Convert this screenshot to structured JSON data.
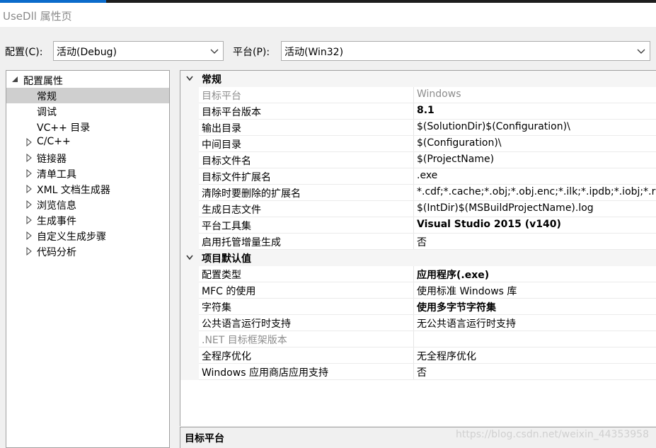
{
  "window": {
    "title": "UseDll 属性页"
  },
  "config": {
    "config_label": "配置(C):",
    "config_value": "活动(Debug)",
    "platform_label": "平台(P):",
    "platform_value": "活动(Win32)"
  },
  "tree": {
    "root": "配置属性",
    "items": [
      "常规",
      "调试",
      "VC++ 目录",
      "C/C++",
      "链接器",
      "清单工具",
      "XML 文档生成器",
      "浏览信息",
      "生成事件",
      "自定义生成步骤",
      "代码分析"
    ],
    "selected": "常规"
  },
  "grid": {
    "cat1": "常规",
    "cat1_rows": [
      {
        "name": "目标平台",
        "value": "Windows"
      },
      {
        "name": "目标平台版本",
        "value": "8.1"
      },
      {
        "name": "输出目录",
        "value": "$(SolutionDir)$(Configuration)\\"
      },
      {
        "name": "中间目录",
        "value": "$(Configuration)\\"
      },
      {
        "name": "目标文件名",
        "value": "$(ProjectName)"
      },
      {
        "name": "目标文件扩展名",
        "value": ".exe"
      },
      {
        "name": "清除时要删除的扩展名",
        "value": "*.cdf;*.cache;*.obj;*.obj.enc;*.ilk;*.ipdb;*.iobj;*.r"
      },
      {
        "name": "生成日志文件",
        "value": "$(IntDir)$(MSBuildProjectName).log"
      },
      {
        "name": "平台工具集",
        "value": "Visual Studio 2015 (v140)"
      },
      {
        "name": "启用托管增量生成",
        "value": "否"
      }
    ],
    "cat2": "项目默认值",
    "cat2_rows": [
      {
        "name": "配置类型",
        "value": "应用程序(.exe)"
      },
      {
        "name": "MFC 的使用",
        "value": "使用标准 Windows 库"
      },
      {
        "name": "字符集",
        "value": "使用多字节字符集"
      },
      {
        "name": "公共语言运行时支持",
        "value": "无公共语言运行时支持"
      },
      {
        "name": ".NET 目标框架版本",
        "value": ""
      },
      {
        "name": "全程序优化",
        "value": "无全程序优化"
      },
      {
        "name": "Windows 应用商店应用支持",
        "value": "否"
      }
    ]
  },
  "description": {
    "title": "目标平台"
  },
  "watermark": "https://blog.csdn.net/weixin_44353958"
}
